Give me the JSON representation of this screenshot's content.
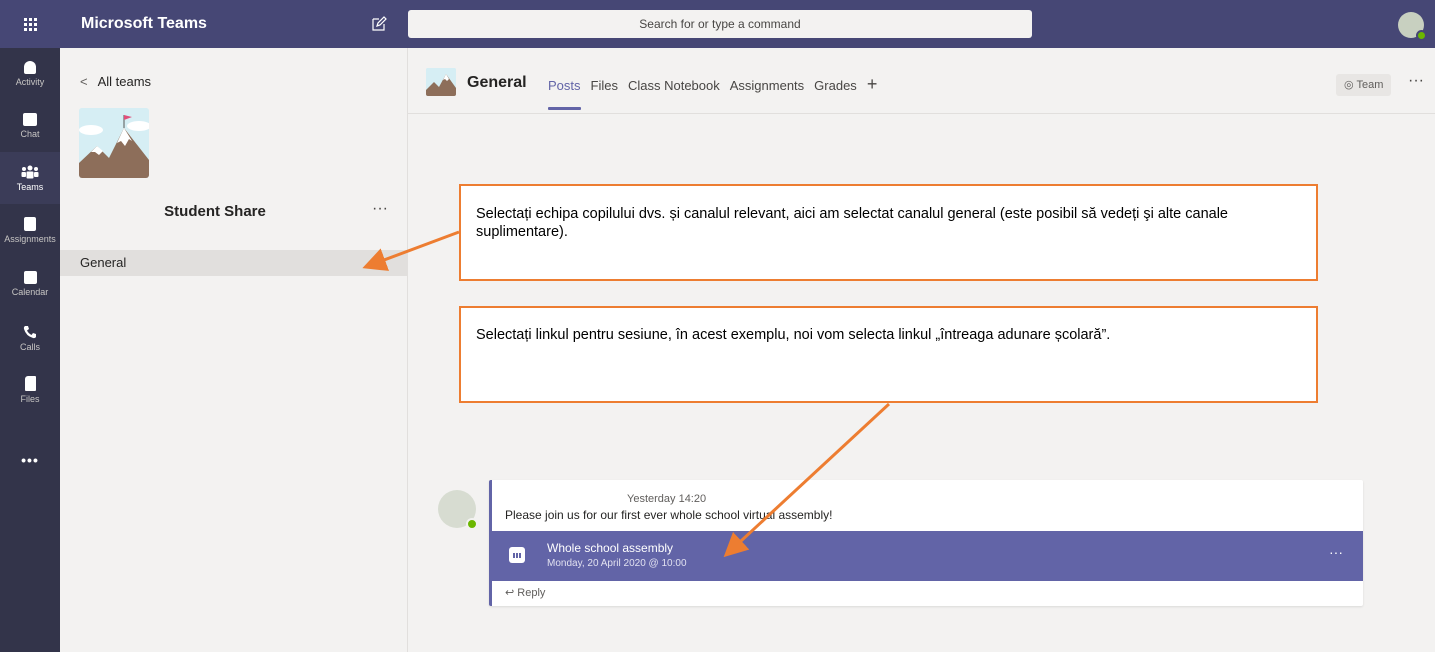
{
  "app": {
    "title": "Microsoft Teams"
  },
  "search": {
    "placeholder": "Search for or type a command"
  },
  "rail": {
    "items": [
      {
        "label": "Activity",
        "icon": "bell-icon"
      },
      {
        "label": "Chat",
        "icon": "chat-icon"
      },
      {
        "label": "Teams",
        "icon": "teams-icon"
      },
      {
        "label": "Assignments",
        "icon": "assignments-icon"
      },
      {
        "label": "Calendar",
        "icon": "calendar-icon"
      },
      {
        "label": "Calls",
        "icon": "phone-icon"
      },
      {
        "label": "Files",
        "icon": "file-icon"
      }
    ],
    "more": "•••"
  },
  "left_panel": {
    "back_label": "All teams",
    "team_name": "Student Share",
    "more": "···",
    "channels": [
      {
        "label": "General"
      }
    ]
  },
  "channel": {
    "title": "General",
    "tabs": [
      {
        "label": "Posts",
        "active": true
      },
      {
        "label": "Files"
      },
      {
        "label": "Class Notebook"
      },
      {
        "label": "Assignments"
      },
      {
        "label": "Grades"
      }
    ],
    "add_tab": "+",
    "team_button": "Team",
    "more": "···"
  },
  "post": {
    "time": "Yesterday 14:20",
    "text": "Please join us for our first ever whole school virtual assembly!",
    "meeting_title": "Whole school assembly",
    "meeting_date": "Monday, 20 April 2020 @ 10:00",
    "meeting_more": "···",
    "reply_label": "Reply"
  },
  "callouts": {
    "first": "Selectați echipa copilului dvs. și canalul relevant, aici am selectat canalul general (este posibil să vedeți şi alte canale suplimentare).",
    "second": "Selectați linkul pentru sesiune, în acest exemplu, noi vom selecta linkul „întreaga adunare școlară”."
  },
  "colors": {
    "topbar": "#464775",
    "rail": "#33344a",
    "accent": "#6264a7",
    "callout_border": "#ed7d31",
    "presence": "#6bb700"
  }
}
